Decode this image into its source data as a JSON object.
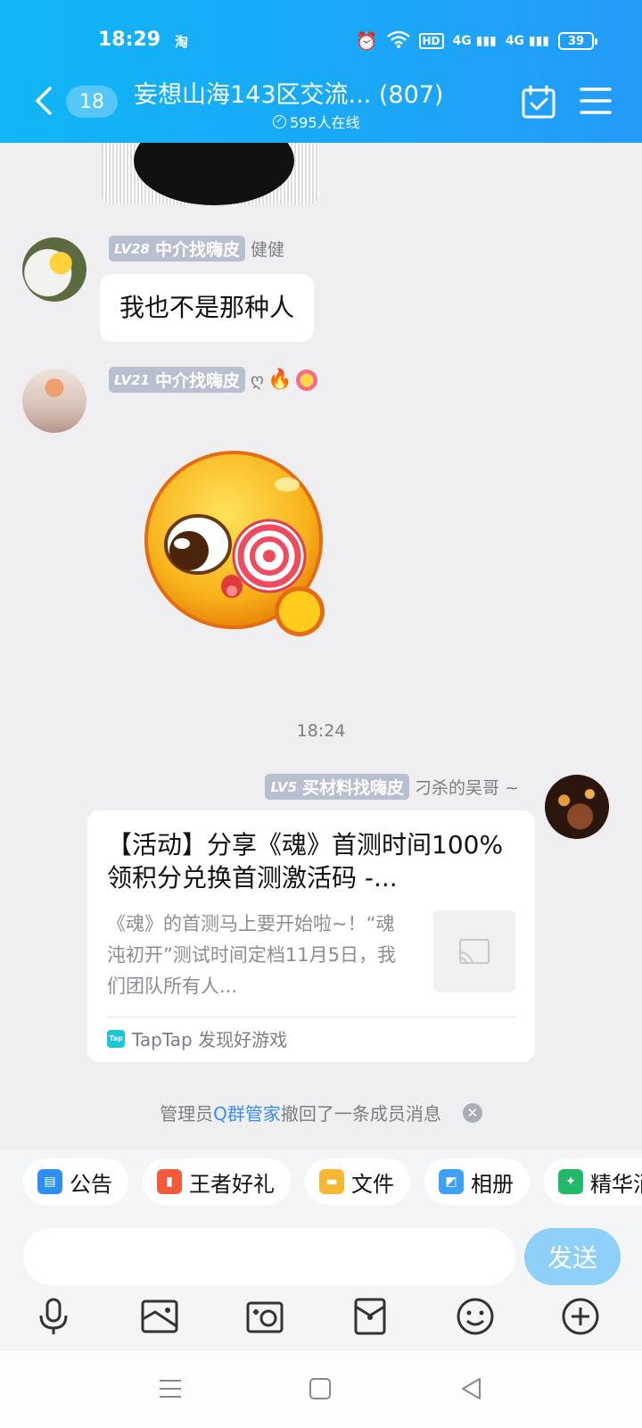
{
  "status": {
    "time": "18:29",
    "app_badge": "淘",
    "icons": [
      "alarm-icon",
      "wifi-icon",
      "hd-icon",
      "signal-4g-icon",
      "signal-4g-icon"
    ],
    "hd": "HD",
    "net1": "4G",
    "net2": "4G",
    "battery": "39"
  },
  "header": {
    "unread": "18",
    "title": "妄想山海143区交流... (807)",
    "online": "595人在线"
  },
  "messages": [
    {
      "level": "LV28",
      "tag": "中介找嗨皮",
      "name": "健健",
      "text": "我也不是那种人"
    },
    {
      "level": "LV21",
      "tag": "中介找嗨皮",
      "name": "ღ",
      "extra_icons": [
        "fire-icon",
        "flower-face-icon"
      ],
      "sticker": "lollipop-eye-face-sticker"
    }
  ],
  "timestamp": "18:24",
  "share": {
    "level": "LV5",
    "tag": "买材料找嗨皮",
    "name": "刁杀的吴哥 ~",
    "title": "【活动】分享《魂》首测时间100%领积分兑换首测激活码 -...",
    "desc": "《魂》的首测马上要开始啦~！“魂沌初开”测试时间定档11月5日，我们团队所有人...",
    "source": "TapTap 发现好游戏",
    "source_logo": "Tap"
  },
  "notice": {
    "prefix": "管理员",
    "link": "Q群管家",
    "suffix": "撤回了一条成员消息"
  },
  "chips": [
    {
      "label": "公告",
      "icon": "notice-icon"
    },
    {
      "label": "王者好礼",
      "icon": "gift-icon"
    },
    {
      "label": "文件",
      "icon": "folder-icon"
    },
    {
      "label": "相册",
      "icon": "album-icon"
    },
    {
      "label": "精华消",
      "icon": "essence-icon"
    }
  ],
  "input": {
    "placeholder": "",
    "send": "发送"
  },
  "toolbar": [
    "microphone-icon",
    "image-icon",
    "camera-icon",
    "red-packet-icon",
    "emoji-icon",
    "plus-icon"
  ],
  "colors": {
    "header_start": "#10b6f5",
    "header_end": "#239bf8",
    "send_button": "#8fd0f8",
    "link": "#3b8df0",
    "badge": "#b8bfcf"
  }
}
